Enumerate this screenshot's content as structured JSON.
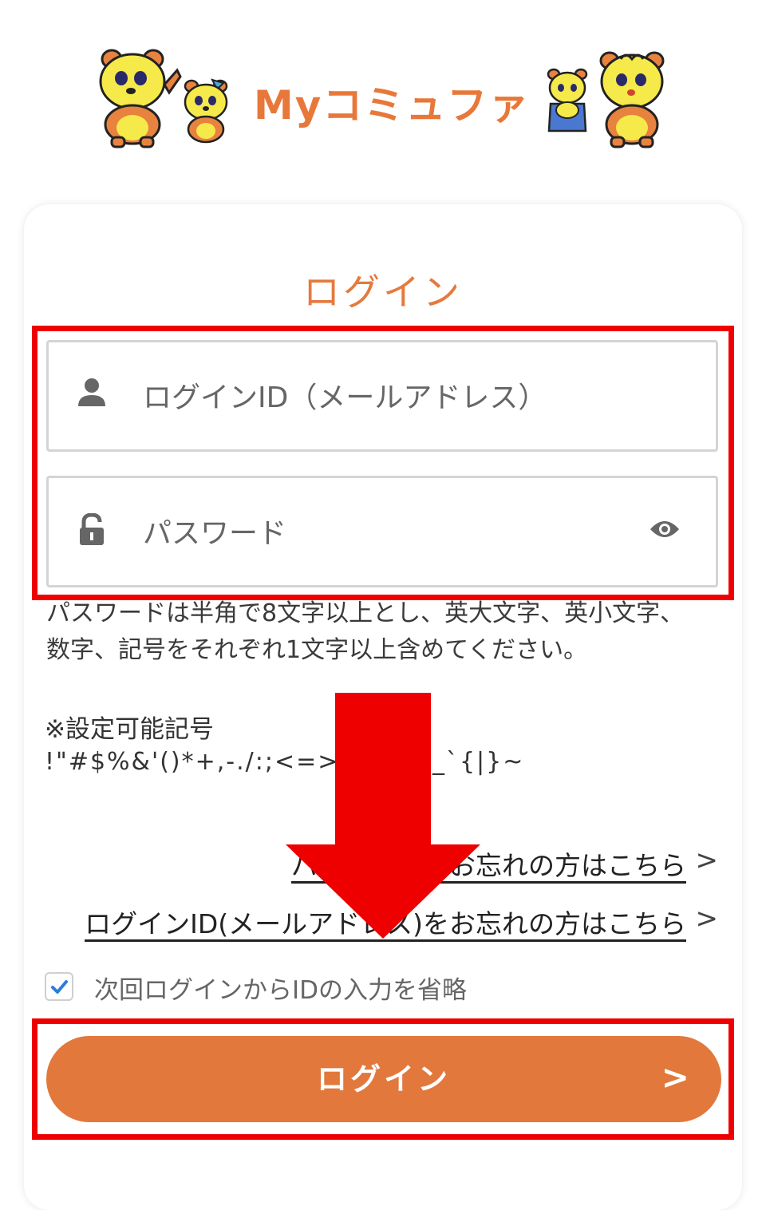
{
  "header": {
    "logo_text": "Myコミュファ"
  },
  "card": {
    "title": "ログイン",
    "login_id_placeholder": "ログインID（メールアドレス）",
    "password_placeholder": "パスワード",
    "password_hint": "パスワードは半角で8文字以上とし、英大文字、英小文字、数字、記号をそれぞれ1文字以上含めてください。",
    "allowed_symbols_title": "※設定可能記号",
    "allowed_symbols": "!\"#$%&'()*+,-./:;<=>?@[\\]^_`{|}~",
    "forgot_password_link": "パスワードをお忘れの方はこちら",
    "forgot_id_link": "ログインID(メールアドレス)をお忘れの方はこちら",
    "chevron": ">",
    "remember_id_label": "次回ログインからIDの入力を省略",
    "remember_id_checked": true,
    "login_button_label": "ログイン",
    "login_button_arrow": ">"
  },
  "icons": {
    "user": "user-icon",
    "lock": "lock-icon",
    "eye": "eye-icon",
    "check": "check-icon"
  },
  "colors": {
    "accent": "#e2783b",
    "title": "#e47a3d",
    "annotation": "#ee0000"
  }
}
